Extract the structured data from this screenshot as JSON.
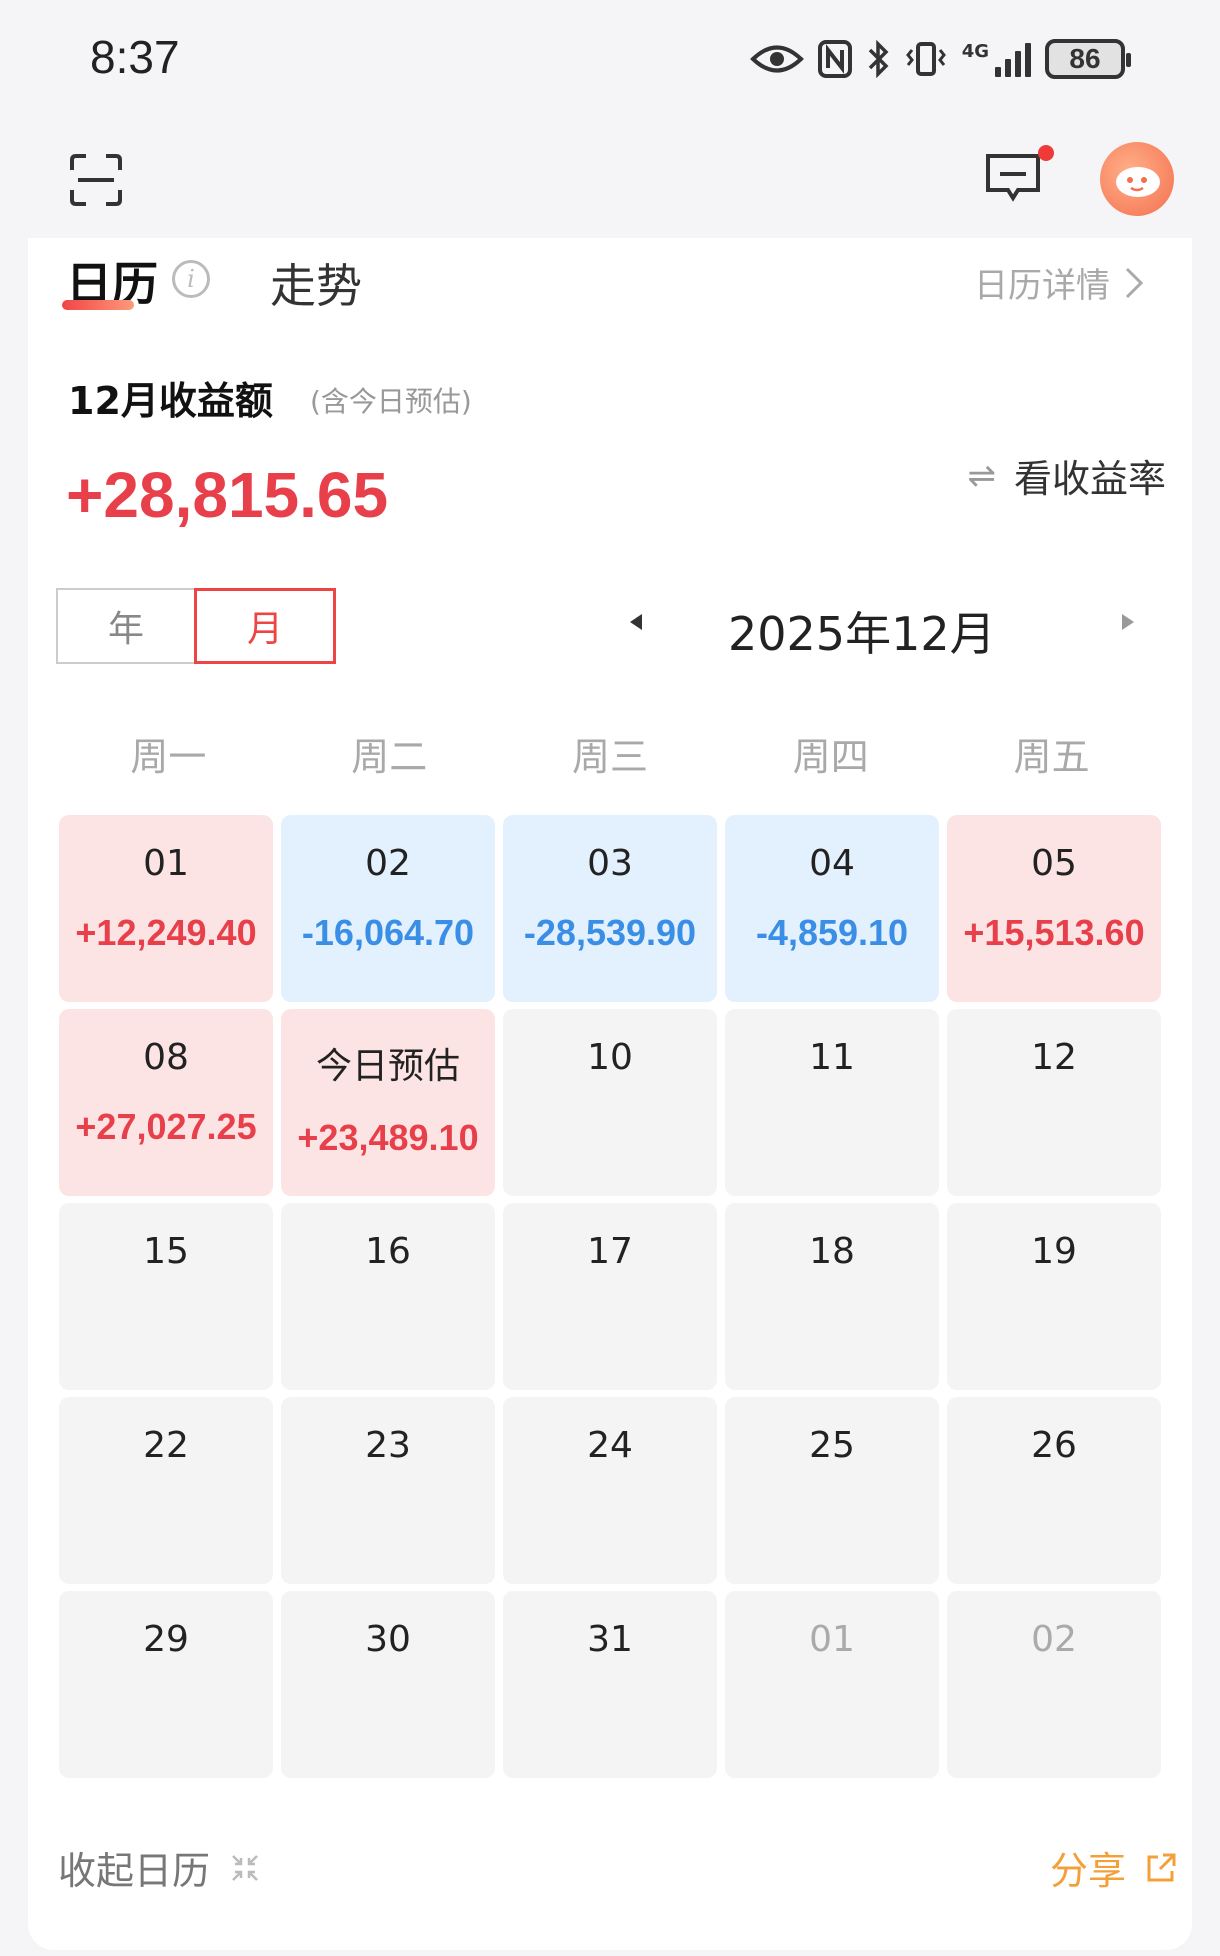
{
  "status_bar": {
    "time": "8:37",
    "network": "4G",
    "battery": "86",
    "icons": [
      "eye-icon",
      "nfc-icon",
      "bluetooth-icon",
      "vibrate-icon",
      "signal-icon",
      "battery-icon"
    ]
  },
  "toolbar": {
    "icons": [
      "scan-icon",
      "message-icon",
      "avatar"
    ],
    "notification_color": "#f03a3a"
  },
  "tabs": {
    "calendar": "日历",
    "trend": "走势",
    "detail_link": "日历详情",
    "info_glyph": "i"
  },
  "summary": {
    "month_label": "12月收益额",
    "month_sub": "(含今日预估)",
    "total": "+28,815.65",
    "rate_link": "看收益率",
    "swap_glyph": "⇌"
  },
  "period": {
    "segments": [
      "年",
      "月"
    ],
    "active_segment": "月",
    "label": "2025年12月"
  },
  "weekdays": [
    "周一",
    "周二",
    "周三",
    "周四",
    "周五"
  ],
  "days": [
    {
      "day": "01",
      "pnl": "+12,249.40",
      "kind": "gain"
    },
    {
      "day": "02",
      "pnl": "-16,064.70",
      "kind": "loss"
    },
    {
      "day": "03",
      "pnl": "-28,539.90",
      "kind": "loss"
    },
    {
      "day": "04",
      "pnl": "-4,859.10",
      "kind": "loss"
    },
    {
      "day": "05",
      "pnl": "+15,513.60",
      "kind": "gain"
    },
    {
      "day": "08",
      "pnl": "+27,027.25",
      "kind": "gain"
    },
    {
      "day": "今日预估",
      "pnl": "+23,489.10",
      "kind": "gain"
    },
    {
      "day": "10",
      "pnl": "",
      "kind": "empty"
    },
    {
      "day": "11",
      "pnl": "",
      "kind": "empty"
    },
    {
      "day": "12",
      "pnl": "",
      "kind": "empty"
    },
    {
      "day": "15",
      "pnl": "",
      "kind": "empty"
    },
    {
      "day": "16",
      "pnl": "",
      "kind": "empty"
    },
    {
      "day": "17",
      "pnl": "",
      "kind": "empty"
    },
    {
      "day": "18",
      "pnl": "",
      "kind": "empty"
    },
    {
      "day": "19",
      "pnl": "",
      "kind": "empty"
    },
    {
      "day": "22",
      "pnl": "",
      "kind": "empty"
    },
    {
      "day": "23",
      "pnl": "",
      "kind": "empty"
    },
    {
      "day": "24",
      "pnl": "",
      "kind": "empty"
    },
    {
      "day": "25",
      "pnl": "",
      "kind": "empty"
    },
    {
      "day": "26",
      "pnl": "",
      "kind": "empty"
    },
    {
      "day": "29",
      "pnl": "",
      "kind": "empty"
    },
    {
      "day": "30",
      "pnl": "",
      "kind": "empty"
    },
    {
      "day": "31",
      "pnl": "",
      "kind": "empty"
    },
    {
      "day": "01",
      "pnl": "",
      "kind": "other"
    },
    {
      "day": "02",
      "pnl": "",
      "kind": "other"
    }
  ],
  "footer": {
    "collapse_label": "收起日历",
    "share_label": "分享"
  },
  "colors": {
    "gain_text": "#e8404a",
    "loss_text": "#3a8ee6",
    "gain_bg": "#fde4e4",
    "loss_bg": "#e3f0fd",
    "share": "#f4a03a"
  }
}
